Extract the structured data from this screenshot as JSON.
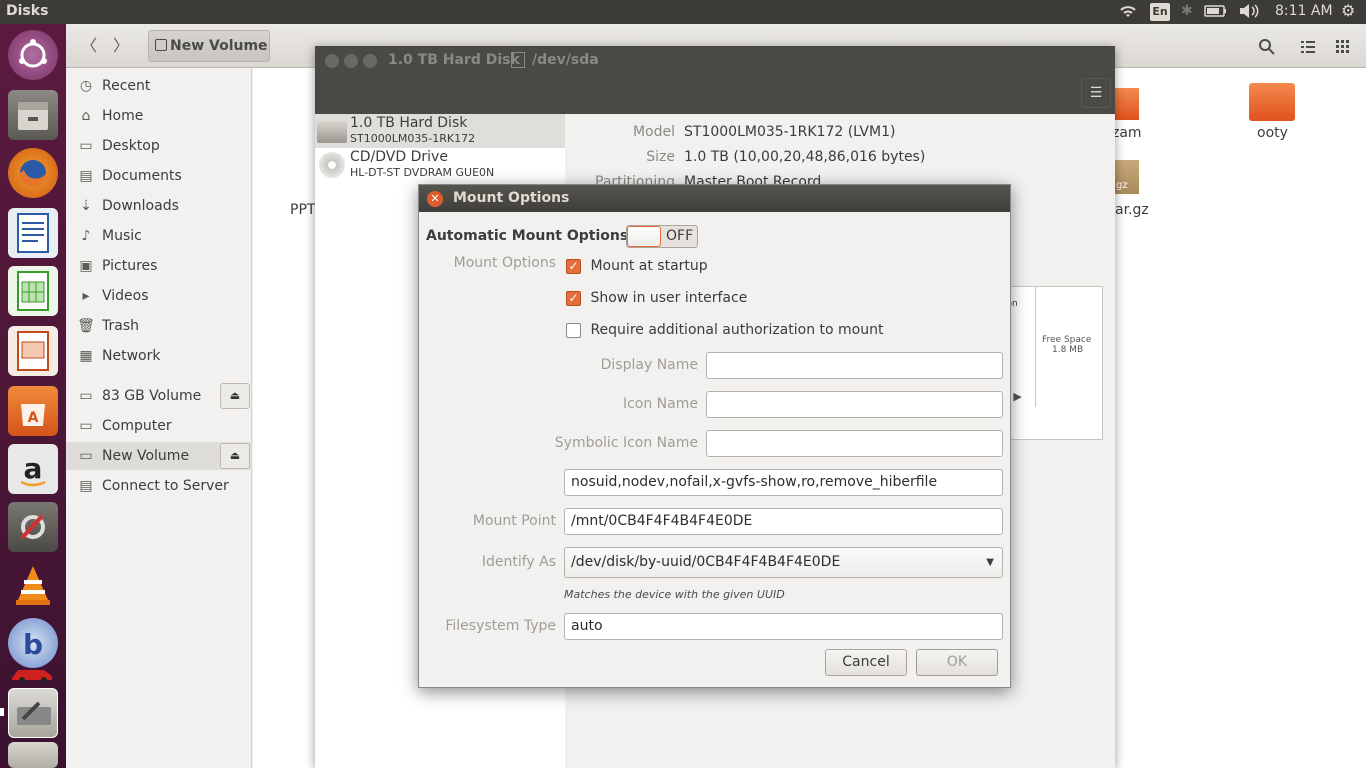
{
  "top_panel": {
    "app_title": "Disks",
    "keyboard_layout": "En",
    "clock": "8:11 AM"
  },
  "navbar": {
    "path_label": "New Volume"
  },
  "sidebar": {
    "items": [
      {
        "label": "Recent",
        "icon": "clock-icon"
      },
      {
        "label": "Home",
        "icon": "home-icon"
      },
      {
        "label": "Desktop",
        "icon": "desktop-icon"
      },
      {
        "label": "Documents",
        "icon": "documents-icon"
      },
      {
        "label": "Downloads",
        "icon": "downloads-icon"
      },
      {
        "label": "Music",
        "icon": "music-icon"
      },
      {
        "label": "Pictures",
        "icon": "pictures-icon"
      },
      {
        "label": "Videos",
        "icon": "videos-icon"
      },
      {
        "label": "Trash",
        "icon": "trash-icon"
      },
      {
        "label": "Network",
        "icon": "network-icon"
      }
    ],
    "devices": [
      {
        "label": "83 GB Volume"
      },
      {
        "label": "Computer"
      },
      {
        "label": "New Volume"
      },
      {
        "label": "Connect to Server"
      }
    ]
  },
  "files": {
    "partial_left": "PPT",
    "partial_1": "zam",
    "partial_2": "ar.gz",
    "partial_3": "gz",
    "ooty": "ooty"
  },
  "disks": {
    "title": "1.0 TB Hard Disk",
    "device_path": "/dev/sda",
    "drives": [
      {
        "name": "1.0 TB Hard Disk",
        "model": "ST1000LM035-1RK172"
      },
      {
        "name": "CD/DVD Drive",
        "model": "HL-DT-ST DVDRAM GUE0N"
      }
    ],
    "info": {
      "model_label": "Model",
      "model_value": "ST1000LM035-1RK172 (LVM1)",
      "size_label": "Size",
      "size_value": "1.0 TB (10,00,20,48,86,016 bytes)",
      "partitioning_label": "Partitioning",
      "partitioning_value": "Master Boot Record"
    },
    "volume_fragments": {
      "ition": "ition",
      "four": "4",
      "e": "e",
      "s": "S",
      "fs": "FS",
      "free_space": "Free Space",
      "free_size": "1.8 MB"
    }
  },
  "dialog": {
    "title": "Mount Options",
    "auto_mount_label": "Automatic Mount Options",
    "switch_state": "OFF",
    "mount_options_label": "Mount Options",
    "checkboxes": [
      {
        "label": "Mount at startup",
        "checked": true
      },
      {
        "label": "Show in user interface",
        "checked": true
      },
      {
        "label": "Require additional authorization to mount",
        "checked": false
      }
    ],
    "display_name_label": "Display Name",
    "display_name_value": "",
    "icon_name_label": "Icon Name",
    "icon_name_value": "",
    "symbolic_icon_name_label": "Symbolic Icon Name",
    "symbolic_icon_name_value": "",
    "options_value": "nosuid,nodev,nofail,x-gvfs-show,ro,remove_hiberfile",
    "mount_point_label": "Mount Point",
    "mount_point_value": "/mnt/0CB4F4F4B4F4E0DE",
    "identify_as_label": "Identify As",
    "identify_as_value": "/dev/disk/by-uuid/0CB4F4F4B4F4E0DE",
    "identify_hint": "Matches the device with the given UUID",
    "fs_type_label": "Filesystem Type",
    "fs_type_value": "auto",
    "cancel_label": "Cancel",
    "ok_label": "OK"
  }
}
